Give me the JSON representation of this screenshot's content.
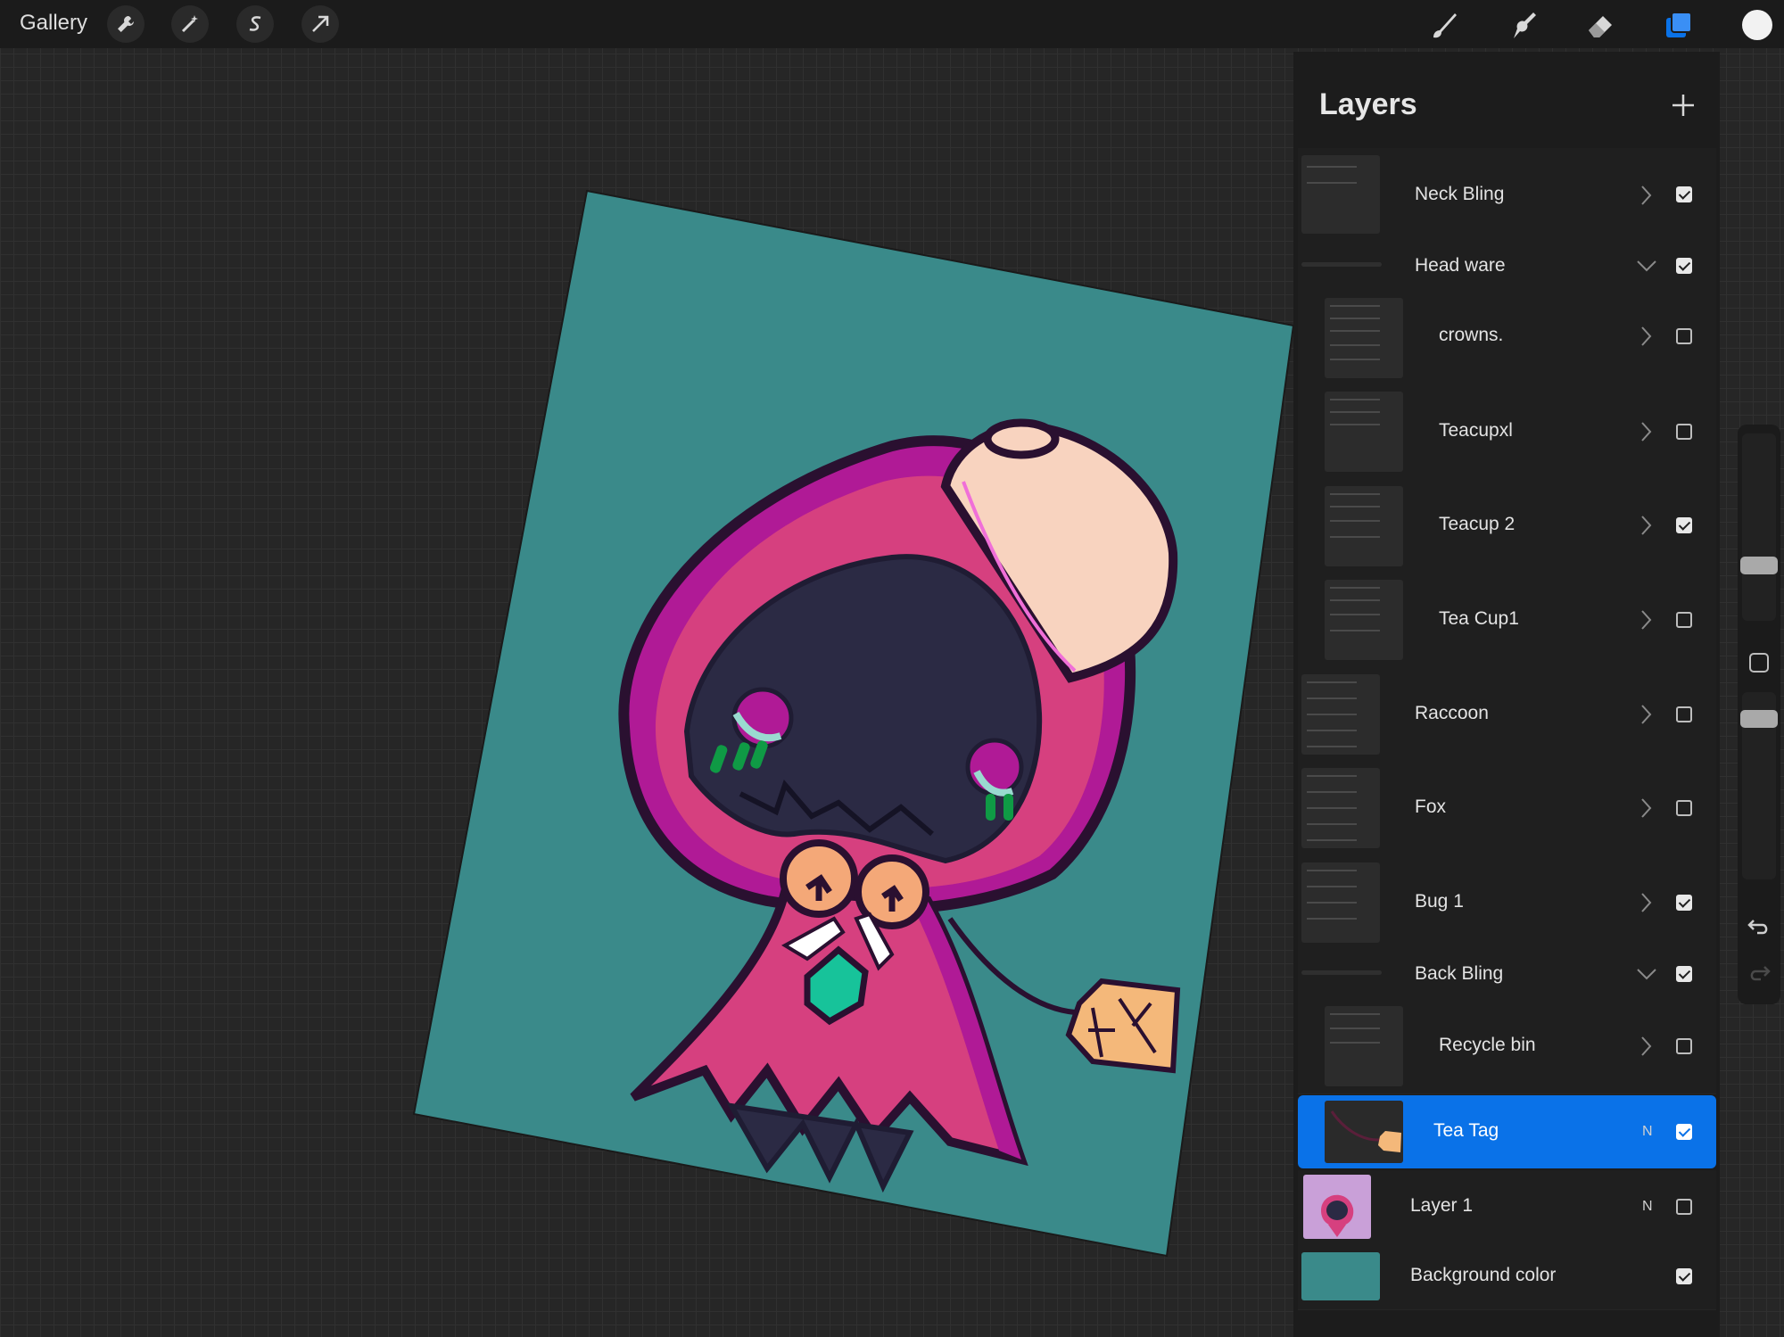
{
  "topbar": {
    "gallery_label": "Gallery",
    "left_tools": [
      "wrench-icon",
      "magic-wand-icon",
      "selection-s-icon",
      "transform-arrow-icon"
    ],
    "right_tools": [
      "brush-icon",
      "smudge-icon",
      "eraser-icon",
      "layers-icon"
    ],
    "active_tool": "layers-icon",
    "current_color": "#f2f2f2"
  },
  "layers_panel": {
    "title": "Layers",
    "layers": [
      {
        "name": "Neck Bling",
        "type": "group",
        "expanded": false,
        "visible": true
      },
      {
        "name": "Head ware",
        "type": "group",
        "expanded": true,
        "visible": true
      },
      {
        "name": "crowns.",
        "type": "group",
        "expanded": false,
        "visible": false,
        "indent": true
      },
      {
        "name": "Teacupxl",
        "type": "group",
        "expanded": false,
        "visible": false,
        "indent": true
      },
      {
        "name": "Teacup 2",
        "type": "group",
        "expanded": false,
        "visible": true,
        "indent": true
      },
      {
        "name": "Tea Cup1",
        "type": "group",
        "expanded": false,
        "visible": false,
        "indent": true
      },
      {
        "name": "Raccoon",
        "type": "group",
        "expanded": false,
        "visible": false
      },
      {
        "name": "Fox",
        "type": "group",
        "expanded": false,
        "visible": false
      },
      {
        "name": "Bug 1",
        "type": "group",
        "expanded": false,
        "visible": true
      },
      {
        "name": "Back Bling",
        "type": "group",
        "expanded": true,
        "visible": true
      },
      {
        "name": "Recycle bin",
        "type": "group",
        "expanded": false,
        "visible": false,
        "indent": true
      },
      {
        "name": "Tea Tag",
        "type": "layer",
        "blend": "N",
        "visible": true,
        "selected": true,
        "indent": true
      },
      {
        "name": "Layer 1",
        "type": "layer",
        "blend": "N",
        "visible": false
      },
      {
        "name": "Background color",
        "type": "background",
        "visible": true
      }
    ]
  },
  "colors": {
    "accent": "#0a72e8",
    "canvas_teal": "#3a8a8a",
    "cloak_pink": "#d6407f",
    "cloak_dark_pink": "#b01a96",
    "face_navy": "#2b2a44",
    "cup_peach": "#f8d3bf",
    "tag_orange": "#f4b87a",
    "gem_green": "#17c39a"
  },
  "sidebar": {
    "undo_icon": "undo-icon",
    "redo_icon": "redo-icon",
    "brush_size_level": 0.7,
    "opacity_level": 0.95
  }
}
